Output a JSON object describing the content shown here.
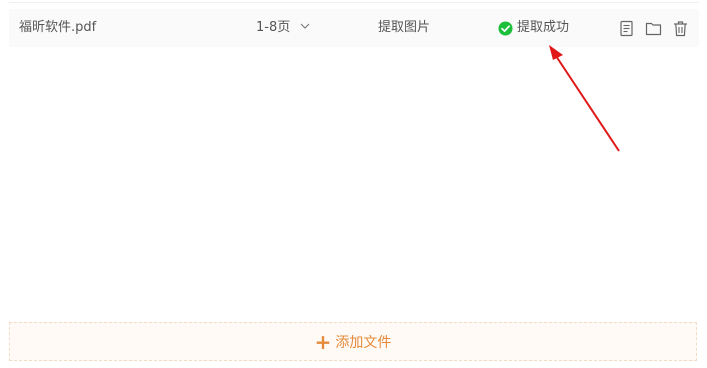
{
  "file_row": {
    "file_name": "福昕软件.pdf",
    "page_range": "1-8页",
    "extract_type": "提取图片",
    "status": "提取成功"
  },
  "icons": {
    "page_range_dropdown": "chevron-down-icon",
    "status": "check-circle-icon",
    "actions": [
      "document-icon",
      "folder-icon",
      "trash-icon"
    ]
  },
  "add_file": {
    "plus": "+",
    "label": "添加文件"
  },
  "colors": {
    "success": "#1dbf3b",
    "accent": "#e58a3a",
    "annotation_arrow": "#e01818"
  }
}
